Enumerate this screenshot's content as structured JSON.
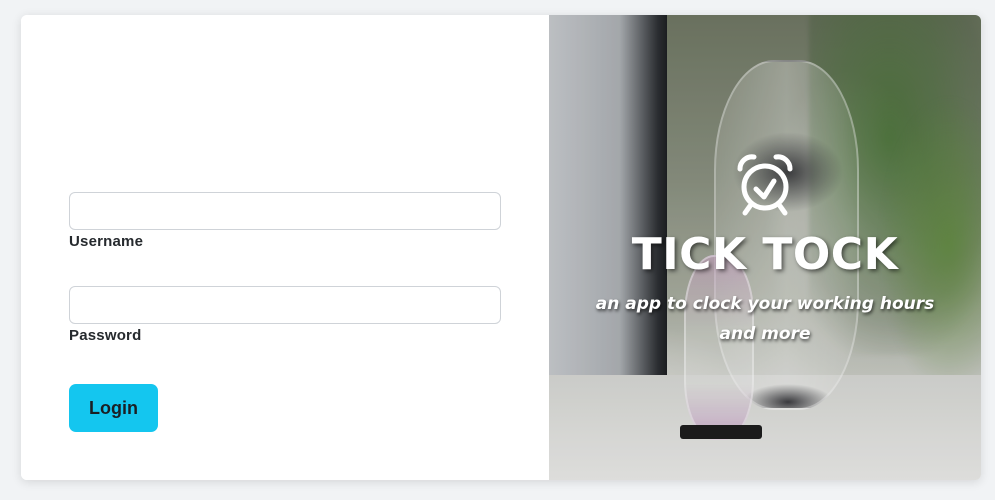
{
  "login_form": {
    "username": {
      "label": "Username",
      "value": "",
      "placeholder": ""
    },
    "password": {
      "label": "Password",
      "value": "",
      "placeholder": ""
    },
    "login_button_label": "Login"
  },
  "hero": {
    "icon": "alarm-clock-icon",
    "title": "TICK TOCK",
    "subtitle": "an app to clock your working hours and more"
  },
  "colors": {
    "accent_button": "#14c6ef",
    "card_background": "#ffffff",
    "page_background": "#f1f3f5",
    "hero_text": "#ffffff"
  }
}
